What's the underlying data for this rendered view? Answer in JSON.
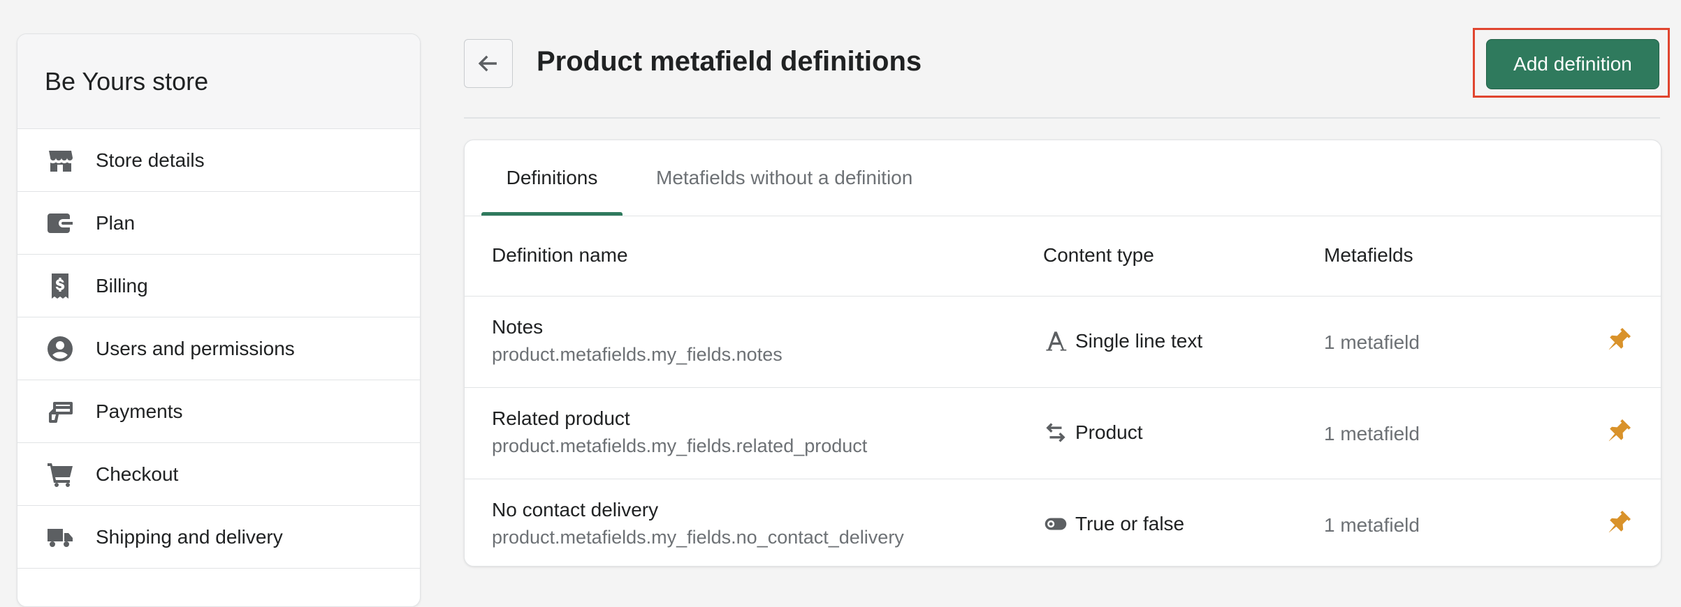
{
  "sidebar": {
    "store_name": "Be Yours store",
    "items": [
      {
        "label": "Store details",
        "icon": "store-icon"
      },
      {
        "label": "Plan",
        "icon": "wallet-icon"
      },
      {
        "label": "Billing",
        "icon": "receipt-dollar-icon"
      },
      {
        "label": "Users and permissions",
        "icon": "user-icon"
      },
      {
        "label": "Payments",
        "icon": "payments-icon"
      },
      {
        "label": "Checkout",
        "icon": "cart-icon"
      },
      {
        "label": "Shipping and delivery",
        "icon": "truck-icon"
      }
    ]
  },
  "header": {
    "title": "Product metafield definitions",
    "back_icon": "arrow-left-icon",
    "add_button_label": "Add definition",
    "accent_color": "#2f7a5d",
    "highlight_color": "#e0452f"
  },
  "tabs": {
    "definitions": "Definitions",
    "without_definition": "Metafields without a definition"
  },
  "table": {
    "headers": {
      "name": "Definition name",
      "type": "Content type",
      "metafields": "Metafields"
    },
    "rows": [
      {
        "name": "Notes",
        "key": "product.metafields.my_fields.notes",
        "type": "Single line text",
        "type_icon": "text-icon",
        "metafields": "1 metafield",
        "pin_icon": "pin-icon"
      },
      {
        "name": "Related product",
        "key": "product.metafields.my_fields.related_product",
        "type": "Product",
        "type_icon": "swap-arrows-icon",
        "metafields": "1 metafield",
        "pin_icon": "pin-icon"
      },
      {
        "name": "No contact delivery",
        "key": "product.metafields.my_fields.no_contact_delivery",
        "type": "True or false",
        "type_icon": "toggle-icon",
        "metafields": "1 metafield",
        "pin_icon": "pin-icon"
      }
    ]
  }
}
